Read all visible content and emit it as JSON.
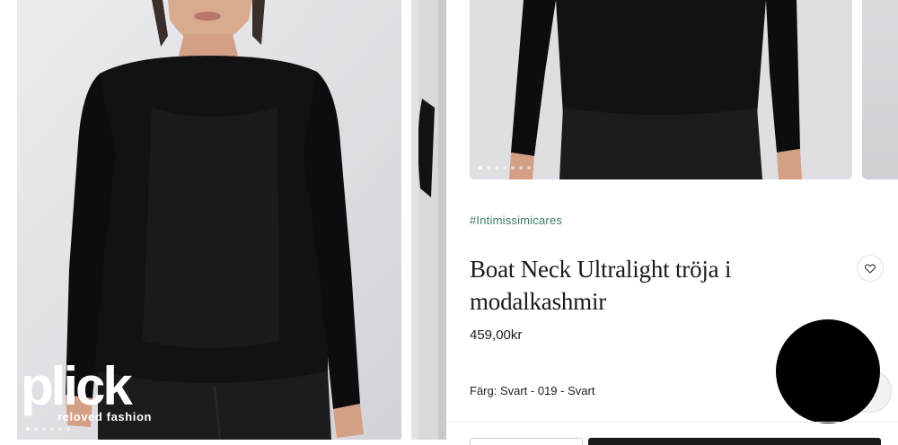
{
  "watermark": {
    "brand": "plick",
    "tagline": "reloved fashion"
  },
  "product": {
    "hashtag": "#Intimissimicares",
    "title": "Boat Neck Ultralight tröja i modalkashmir",
    "price": "459,00kr",
    "color_line": "Färg: Svart - 019 - Svart"
  },
  "gallery": {
    "left_dots_count": 6,
    "left_active_dot": 0,
    "right_dots_count": 7,
    "right_active_dot": 0
  },
  "colors": {
    "hashtag": "#3d7a5a",
    "garment": "#121214",
    "text": "#1b1b1b"
  },
  "icons": {
    "wishlist": "heart-icon"
  }
}
